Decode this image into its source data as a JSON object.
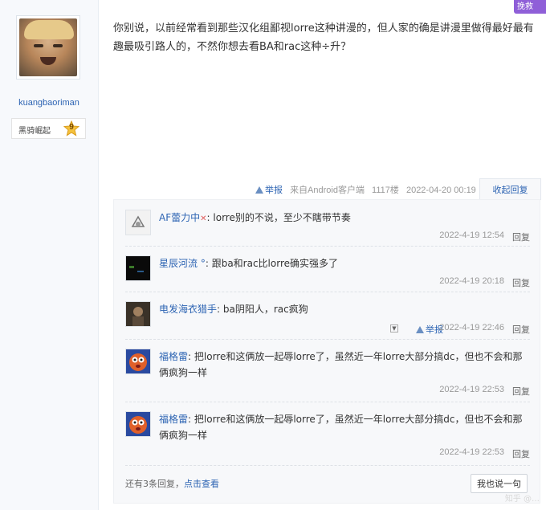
{
  "author": {
    "username": "kuangbaoriman",
    "level_name": "黑骑崛起",
    "level_num": "9"
  },
  "corner_tag": "挽救",
  "post": {
    "text": "你别说，以前经常看到那些汉化组鄙视lorre这种讲漫的，但人家的确是讲漫里做得最好最有趣最吸引路人的，不然你想去看BA和rac这种÷升？",
    "report_label": "举报",
    "source": "来自Android客户端",
    "floor": "1117楼",
    "time": "2022-04-20 00:19",
    "fold_label": "收起回复"
  },
  "replies": [
    {
      "name": "AF蕾力中",
      "sep": ":",
      "text": "lorre别的不说，至少不瞎带节奏",
      "time": "2022-4-19 12:54",
      "reply_label": "回复"
    },
    {
      "name": "星辰河流 °",
      "sep": ":",
      "text": "跟ba和rac比lorre确实强多了",
      "time": "2022-4-19 20:18",
      "reply_label": "回复"
    },
    {
      "name": "电发海衣猎手",
      "sep": ":",
      "text": "ba阴阳人，rac疯狗",
      "time": "2022-4-19 22:46",
      "reply_label": "回复",
      "report_label": "举报"
    },
    {
      "name": "福格雷",
      "sep": ":",
      "text": "把lorre和这俩放一起辱lorre了，虽然近一年lorre大部分搞dc，但也不会和那俩疯狗一样",
      "time": "2022-4-19 22:53",
      "reply_label": "回复"
    },
    {
      "name": "福格雷",
      "sep": ":",
      "text": "把lorre和这俩放一起辱lorre了，虽然近一年lorre大部分搞dc，但也不会和那俩疯狗一样",
      "time": "2022-4-19 22:53",
      "reply_label": "回复"
    }
  ],
  "more": {
    "text": "还有3条回复，",
    "link": "点击查看"
  },
  "say_button": "我也说一句",
  "watermark": "知乎 @…"
}
